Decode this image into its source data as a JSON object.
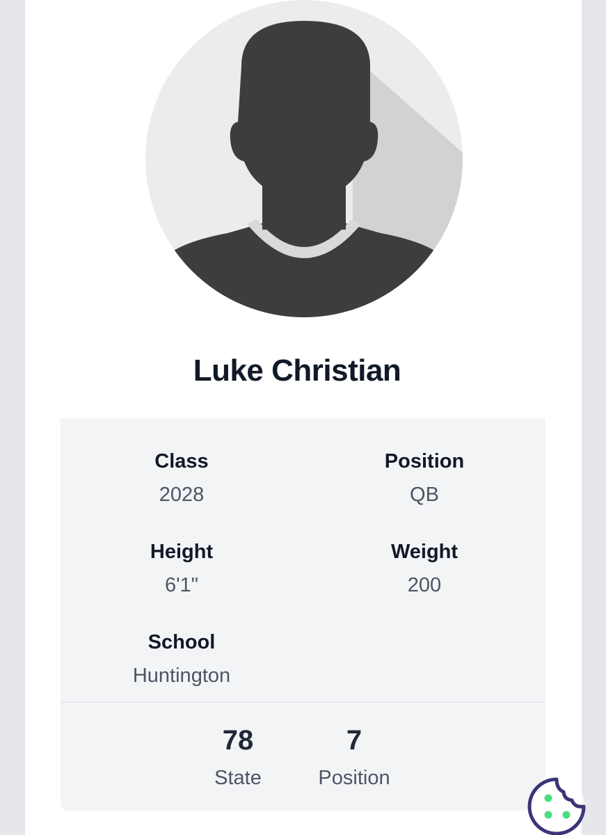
{
  "player": {
    "name": "Luke Christian"
  },
  "details": {
    "class_label": "Class",
    "class_value": "2028",
    "position_label": "Position",
    "position_value": "QB",
    "height_label": "Height",
    "height_value": "6'1\"",
    "weight_label": "Weight",
    "weight_value": "200",
    "school_label": "School",
    "school_value": "Huntington"
  },
  "rankings": {
    "state_value": "78",
    "state_label": "State",
    "position_value": "7",
    "position_label": "Position"
  },
  "icons": {
    "avatar": "player-silhouette-icon",
    "cookie": "cookie-icon"
  },
  "colors": {
    "page_background": "#e5e7eb",
    "card_background": "#ffffff",
    "info_background": "#f3f4f6",
    "heading": "#111827",
    "muted_text": "#4b5563",
    "cookie_outline": "#3b3577",
    "cookie_dots": "#4ade80"
  }
}
